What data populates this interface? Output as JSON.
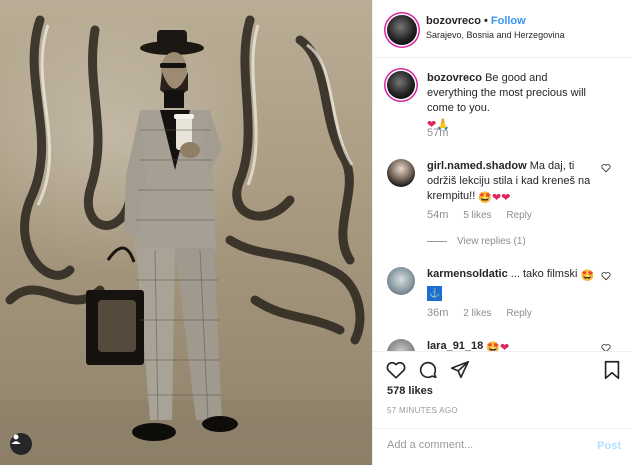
{
  "post": {
    "username": "bozovreco",
    "follow_label": "Follow",
    "dot": "•",
    "location": "Sarajevo, Bosnia and Herzegovina"
  },
  "caption": {
    "username": "bozovreco",
    "text": "Be good and everything the most precious will come to you.",
    "emojis": "❤🙏",
    "time": "57m"
  },
  "comments": [
    {
      "username": "girl.named.shadow",
      "text": "Ma daj, ti održiš lekciju stila i kad kreneš na krempitu!!",
      "emojis": "🤩❤❤",
      "time": "54m",
      "likes": "5 likes",
      "reply_label": "Reply",
      "view_replies": "View replies (1)"
    },
    {
      "username": "karmensoldatic",
      "text": "... tako filmski",
      "emojis": "🤩",
      "emoji_line2": "⚓",
      "time": "36m",
      "likes": "2 likes",
      "reply_label": "Reply"
    },
    {
      "username": "lara_91_18",
      "emojis": "🤩❤"
    }
  ],
  "likes_count": "578 likes",
  "posted_ago": "57 MINUTES AGO",
  "add_comment": {
    "placeholder": "Add a comment...",
    "post_label": "Post"
  },
  "icons": {
    "like": "heart-icon",
    "comment": "comment-icon",
    "share": "share-icon",
    "save": "bookmark-icon",
    "tag": "user-tag-icon"
  },
  "colors": {
    "link": "#3897f0",
    "post_disabled": "#b2dffc",
    "text": "#262626",
    "muted": "#8e8e8e"
  }
}
